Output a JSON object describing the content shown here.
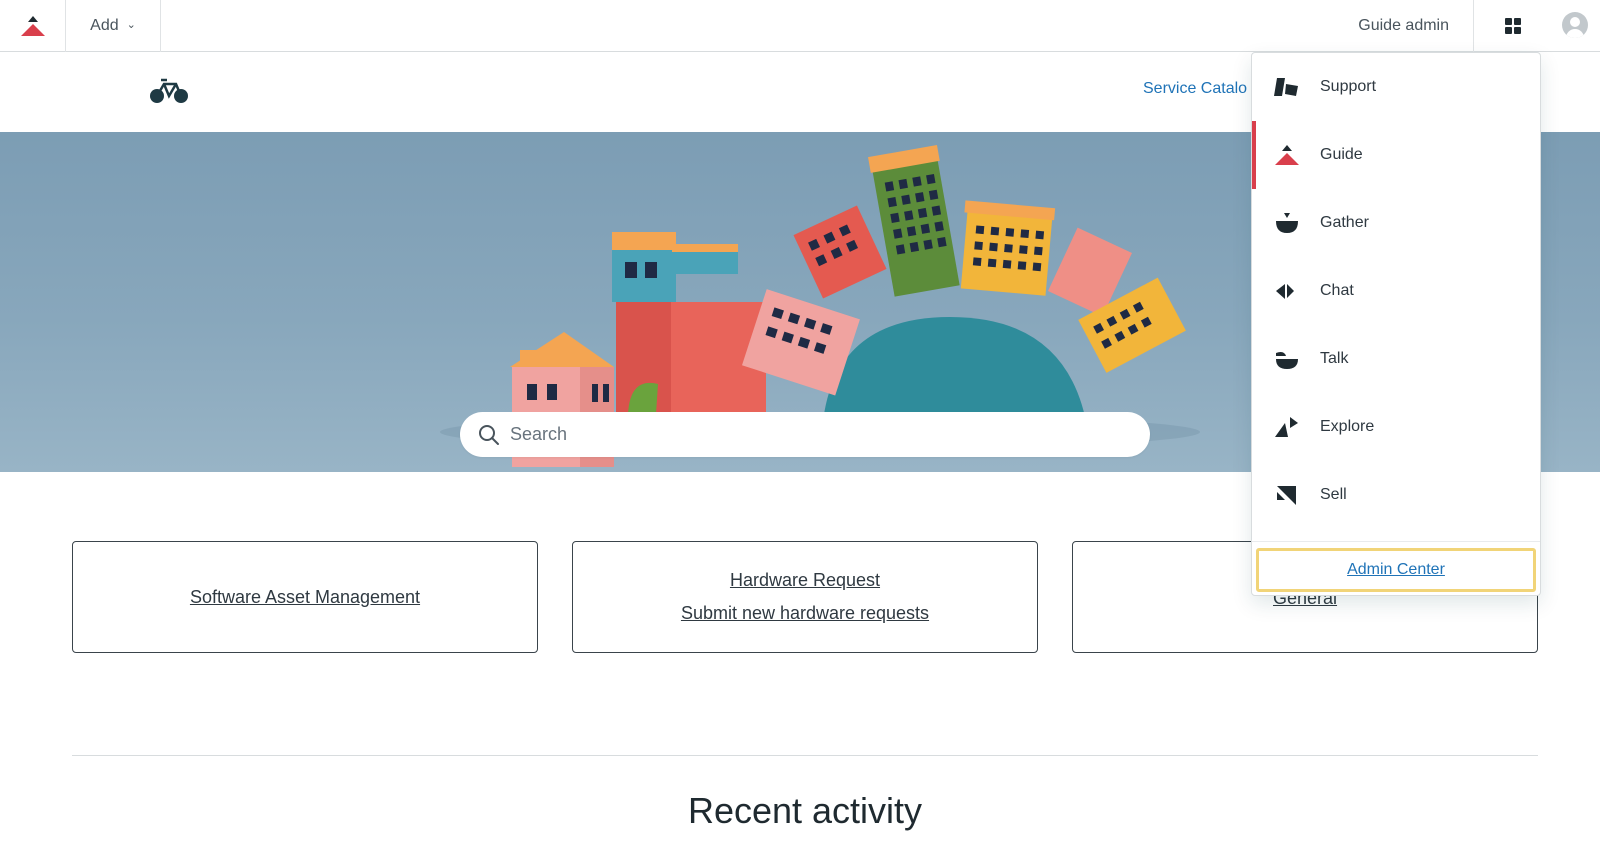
{
  "topbar": {
    "add_label": "Add",
    "user_label": "Guide admin",
    "icons": [
      "zendesk-guide-logo-icon",
      "chevron-down-icon",
      "product-tray-icon",
      "user-avatar-icon"
    ]
  },
  "header": {
    "logo": "bicycle-logo-icon",
    "nav_link": "Service Catalo"
  },
  "hero": {
    "search_placeholder": "Search"
  },
  "blocks": [
    {
      "title": "Software Asset Management",
      "description": ""
    },
    {
      "title": "Hardware Request",
      "description": "Submit new hardware requests"
    },
    {
      "title": "General",
      "description": ""
    }
  ],
  "recent_activity": {
    "title": "Recent activity"
  },
  "product_menu": {
    "items": [
      {
        "label": "Support",
        "icon": "support-icon",
        "active": false
      },
      {
        "label": "Guide",
        "icon": "guide-icon",
        "active": true
      },
      {
        "label": "Gather",
        "icon": "gather-icon",
        "active": false
      },
      {
        "label": "Chat",
        "icon": "chat-icon",
        "active": false
      },
      {
        "label": "Talk",
        "icon": "talk-icon",
        "active": false
      },
      {
        "label": "Explore",
        "icon": "explore-icon",
        "active": false
      },
      {
        "label": "Sell",
        "icon": "sell-icon",
        "active": false
      }
    ],
    "admin_link": "Admin Center",
    "accent_color": "#d93f4c",
    "highlight_color": "#f1d478"
  },
  "colors": {
    "link": "#1f73b7",
    "text": "#2f3941",
    "hero_bg": "#88a7bc"
  }
}
